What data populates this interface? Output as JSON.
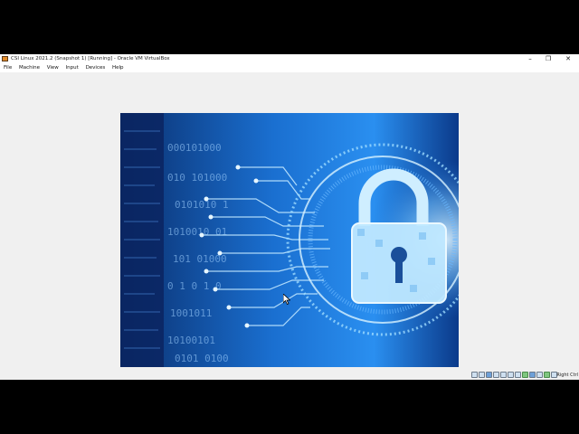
{
  "window": {
    "title": "CSI Linux 2021.2 (Snapshot 1) [Running] - Oracle VM VirtualBox",
    "controls": {
      "minimize": "–",
      "maximize": "❐",
      "close": "✕"
    }
  },
  "menu": [
    "File",
    "Machine",
    "View",
    "Input",
    "Devices",
    "Help"
  ],
  "statusbar": {
    "host_key": "Right Ctrl",
    "icons": [
      "hard-disk-icon",
      "optical-drive-icon",
      "audio-icon",
      "network-icon",
      "usb-icon",
      "shared-folders-icon",
      "display-icon",
      "video-capture-icon",
      "mouse-integration-icon",
      "cpu-icon",
      "guest-additions-icon",
      "keyboard-icon"
    ]
  },
  "guest_screen": {
    "binary_rows": [
      "000101000",
      "010 101000",
      "0101010 1",
      "1010010 01",
      "101 01000",
      "0 1 0 1 0",
      "1001011",
      "10100101",
      "0101 0100"
    ]
  }
}
